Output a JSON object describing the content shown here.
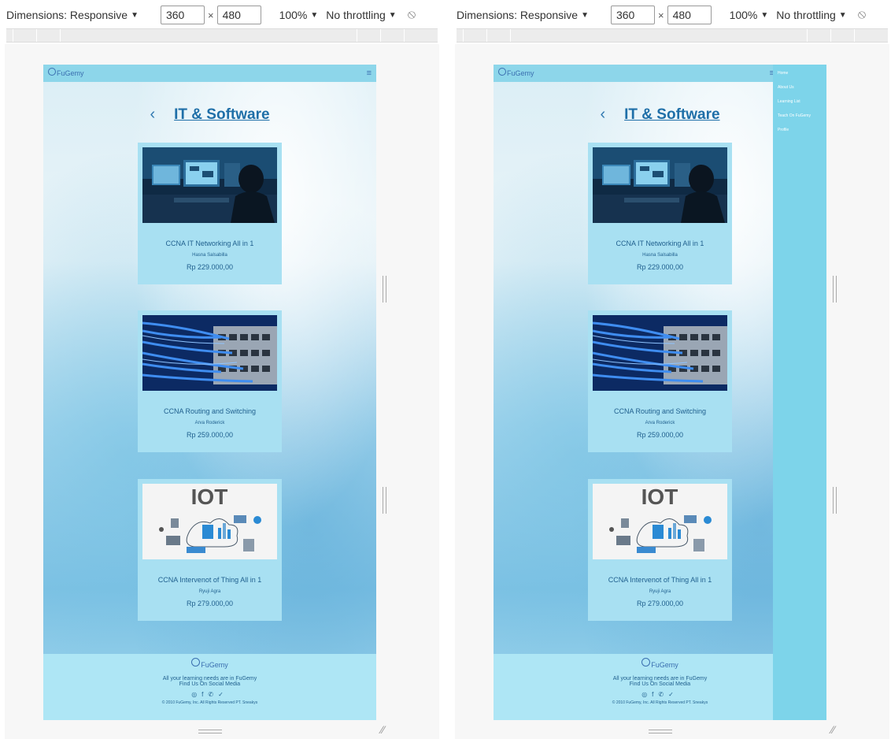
{
  "devtools": {
    "dimensions_label": "Dimensions: Responsive",
    "width": "360",
    "height": "480",
    "times": "×",
    "zoom": "100%",
    "throttling": "No throttling"
  },
  "site": {
    "logo": "FuGemy",
    "page_title": "IT & Software",
    "courses": [
      {
        "name": "CCNA IT Networking All in 1",
        "author": "Hasna Salsabilla",
        "price": "Rp 229.000,00",
        "image": "it-operator-monitor-photo"
      },
      {
        "name": "CCNA Routing and Switching",
        "author": "Arva Roderick",
        "price": "Rp 259.000,00",
        "image": "network-switch-cables-photo"
      },
      {
        "name": "CCNA Intervenot of Thing All in 1",
        "author": "Ryuji Agra",
        "price": "Rp 279.000,00",
        "image": "iot-illustration",
        "image_text": "IOT"
      }
    ],
    "footer": {
      "logo": "FuGemy",
      "tagline": "All your learning needs are in FuGemy",
      "find": "Find Us On Social Media",
      "copyright": "© 2010 FuGemy, Inc. All Rights Reserved PT. Sneakys"
    },
    "menu": [
      "Home",
      "About Us",
      "Learning List",
      "Teach On FuGemy",
      "Profile"
    ]
  },
  "colors": {
    "nav": "#8dd6ea",
    "card": "#a8e0f2",
    "footer": "#aee6f5",
    "title": "#1f6fa8",
    "menu": "#7dd4ea"
  }
}
